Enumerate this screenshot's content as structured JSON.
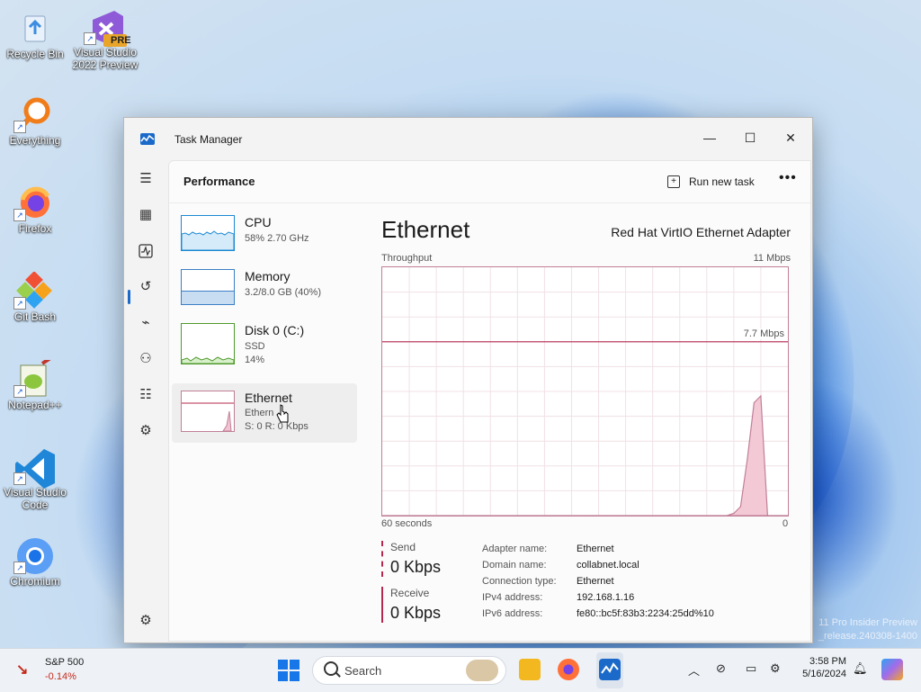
{
  "desktop": {
    "icons": [
      {
        "label": "Recycle Bin"
      },
      {
        "label": "Visual Studio 2022 Preview",
        "badge": "PRE"
      },
      {
        "label": "Everything"
      },
      {
        "label": "Firefox"
      },
      {
        "label": "Git Bash"
      },
      {
        "label": "Notepad++"
      },
      {
        "label": "Visual Studio Code"
      },
      {
        "label": "Chromium"
      }
    ],
    "watermark_line1": "11 Pro Insider Preview",
    "watermark_line2": "_release.240308-1400"
  },
  "window": {
    "title": "Task Manager",
    "minimize": "—",
    "maximize": "☐",
    "close": "✕"
  },
  "page": {
    "title": "Performance",
    "run_new_task": "Run new task",
    "more": "•••"
  },
  "devices": [
    {
      "name": "CPU",
      "sub1": "58% 2.70 GHz",
      "sub2": ""
    },
    {
      "name": "Memory",
      "sub1": "3.2/8.0 GB (40%)",
      "sub2": ""
    },
    {
      "name": "Disk 0 (C:)",
      "sub1": "SSD",
      "sub2": "14%"
    },
    {
      "name": "Ethernet",
      "sub1": "Ethern",
      "sub2": "S: 0 R: 0 Kbps"
    }
  ],
  "detail": {
    "title": "Ethernet",
    "adapter": "Red Hat VirtIO Ethernet Adapter",
    "throughput_label": "Throughput",
    "max_label": "11 Mbps",
    "line_label": "7.7 Mbps",
    "time_label": "60 seconds",
    "zero_label": "0",
    "send_label": "Send",
    "send_value": "0 Kbps",
    "receive_label": "Receive",
    "receive_value": "0 Kbps",
    "properties": [
      {
        "key": "Adapter name:",
        "value": "Ethernet"
      },
      {
        "key": "Domain name:",
        "value": "collabnet.local"
      },
      {
        "key": "Connection type:",
        "value": "Ethernet"
      },
      {
        "key": "IPv4 address:",
        "value": "192.168.1.16"
      },
      {
        "key": "IPv6 address:",
        "value": "fe80::bc5f:83b3:2234:25dd%10"
      }
    ]
  },
  "chart_data": {
    "type": "area",
    "title": "",
    "xlabel": "60 seconds",
    "ylabel": "Throughput",
    "xlim": [
      60,
      0
    ],
    "ylim": [
      0,
      11
    ],
    "y_unit": "Mbps",
    "reference_line": 7.7,
    "x": [
      60,
      55,
      50,
      45,
      40,
      35,
      30,
      25,
      20,
      15,
      10,
      9,
      8,
      7,
      6,
      5,
      4,
      3,
      2,
      1,
      0
    ],
    "series": [
      {
        "values": [
          0,
          0,
          0,
          0,
          0,
          0,
          0,
          0,
          0,
          0,
          0,
          0,
          0.1,
          0.4,
          2.5,
          5.0,
          5.3,
          0,
          0,
          0,
          0
        ],
        "color": "#c17f97"
      }
    ],
    "grid": true
  },
  "taskbar": {
    "widget_title": "S&P 500",
    "widget_change": "-0.14%",
    "search_placeholder": "Search",
    "time": "3:58 PM",
    "date": "5/16/2024"
  }
}
